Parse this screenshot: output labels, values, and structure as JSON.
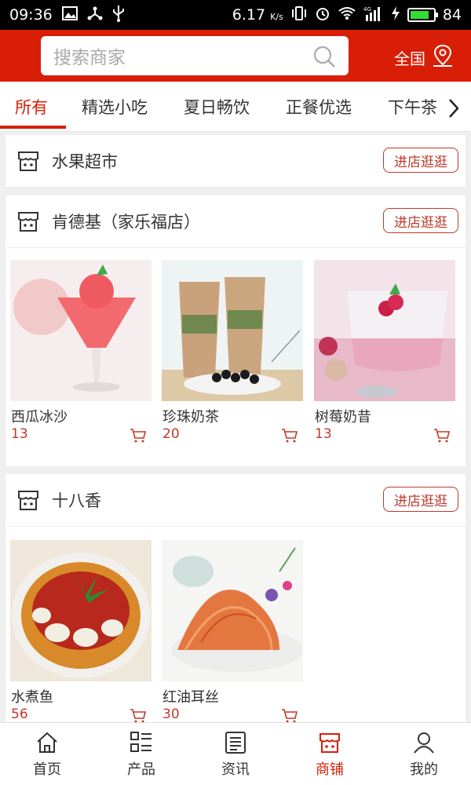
{
  "status_bar": {
    "time": "09:36",
    "speed": "6.17",
    "speed_unit": "K/s",
    "battery": "84",
    "battery_fraction": 0.84,
    "network": "4G"
  },
  "header": {
    "search_placeholder": "搜索商家",
    "region": "全国"
  },
  "tabs": [
    {
      "label": "所有",
      "active": true
    },
    {
      "label": "精选小吃"
    },
    {
      "label": "夏日畅饮"
    },
    {
      "label": "正餐优选"
    },
    {
      "label": "下午茶"
    }
  ],
  "stores": [
    {
      "name": "水果超市",
      "visit_label": "进店逛逛",
      "products": []
    },
    {
      "name": "肯德基（家乐福店）",
      "visit_label": "进店逛逛",
      "products": [
        {
          "name": "西瓜冰沙",
          "price": "13"
        },
        {
          "name": "珍珠奶茶",
          "price": "20"
        },
        {
          "name": "树莓奶昔",
          "price": "13"
        }
      ]
    },
    {
      "name": "十八香",
      "visit_label": "进店逛逛",
      "products": [
        {
          "name": "水煮鱼",
          "price": "56"
        },
        {
          "name": "红油耳丝",
          "price": "30"
        }
      ]
    }
  ],
  "bottom_nav": [
    {
      "label": "首页",
      "icon": "home-icon"
    },
    {
      "label": "产品",
      "icon": "product-list-icon"
    },
    {
      "label": "资讯",
      "icon": "news-icon"
    },
    {
      "label": "商铺",
      "icon": "store-icon",
      "active": true
    },
    {
      "label": "我的",
      "icon": "user-icon"
    }
  ],
  "colors": {
    "brand": "#d81e06",
    "price": "#c0392b"
  }
}
